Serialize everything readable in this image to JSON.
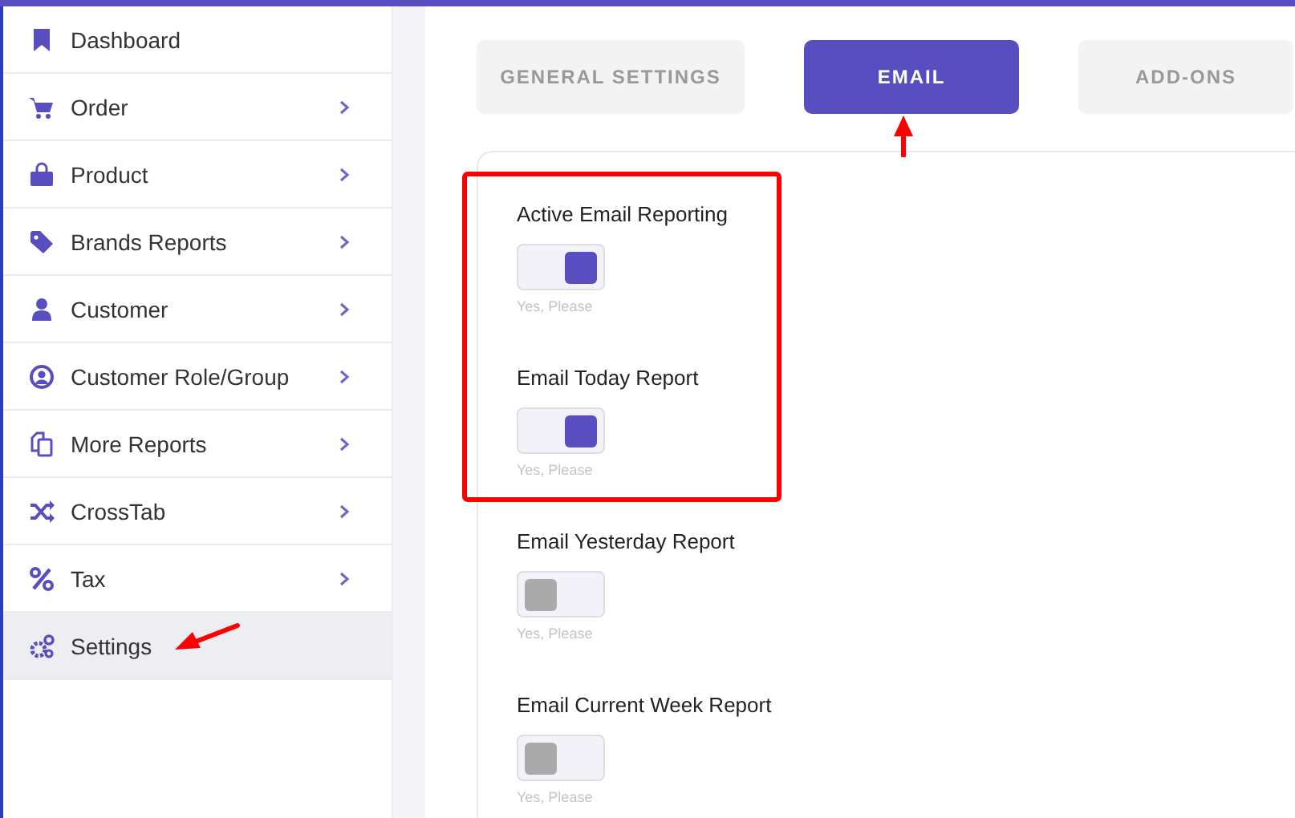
{
  "sidebar": {
    "items": [
      {
        "label": "Dashboard",
        "expandable": false,
        "selected": false
      },
      {
        "label": "Order",
        "expandable": true,
        "selected": false
      },
      {
        "label": "Product",
        "expandable": true,
        "selected": false
      },
      {
        "label": "Brands Reports",
        "expandable": true,
        "selected": false
      },
      {
        "label": "Customer",
        "expandable": true,
        "selected": false
      },
      {
        "label": "Customer Role/Group",
        "expandable": true,
        "selected": false
      },
      {
        "label": "More Reports",
        "expandable": true,
        "selected": false
      },
      {
        "label": "CrossTab",
        "expandable": true,
        "selected": false
      },
      {
        "label": "Tax",
        "expandable": true,
        "selected": false
      },
      {
        "label": "Settings",
        "expandable": false,
        "selected": true
      }
    ]
  },
  "tabs": [
    {
      "label": "GENERAL SETTINGS",
      "selected": false
    },
    {
      "label": "EMAIL",
      "selected": true
    },
    {
      "label": "ADD-ONS",
      "selected": false
    }
  ],
  "settings": [
    {
      "label": "Active Email Reporting",
      "on": true,
      "hint": "Yes, Please"
    },
    {
      "label": "Email Today Report",
      "on": true,
      "hint": "Yes, Please"
    },
    {
      "label": "Email Yesterday Report",
      "on": false,
      "hint": "Yes, Please"
    },
    {
      "label": "Email Current Week Report",
      "on": false,
      "hint": "Yes, Please"
    }
  ]
}
